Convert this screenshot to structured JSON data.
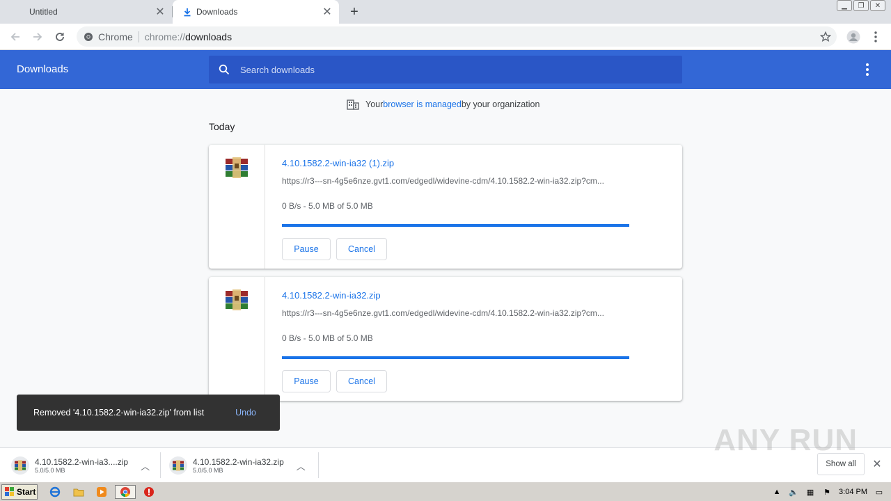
{
  "browser": {
    "tabs": [
      {
        "title": "Untitled",
        "active": false
      },
      {
        "title": "Downloads",
        "active": true
      }
    ],
    "new_tab_label": "+",
    "omnibox": {
      "chip_label": "Chrome",
      "url_scheme": "chrome://",
      "url_path": "downloads"
    }
  },
  "downloads_page": {
    "title": "Downloads",
    "search_placeholder": "Search downloads",
    "managed_notice": {
      "prefix": "Your ",
      "link": "browser is managed",
      "suffix": " by your organization"
    },
    "section_label": "Today",
    "items": [
      {
        "filename": "4.10.1582.2-win-ia32 (1).zip",
        "url": "https://r3---sn-4g5e6nze.gvt1.com/edgedl/widevine-cdm/4.10.1582.2-win-ia32.zip?cm...",
        "status": "0 B/s - 5.0 MB of 5.0 MB",
        "progress_percent": 100,
        "pause_label": "Pause",
        "cancel_label": "Cancel"
      },
      {
        "filename": "4.10.1582.2-win-ia32.zip",
        "url": "https://r3---sn-4g5e6nze.gvt1.com/edgedl/widevine-cdm/4.10.1582.2-win-ia32.zip?cm...",
        "status": "0 B/s - 5.0 MB of 5.0 MB",
        "progress_percent": 100,
        "pause_label": "Pause",
        "cancel_label": "Cancel"
      }
    ],
    "toast": {
      "message": "Removed '4.10.1582.2-win-ia32.zip' from list",
      "action": "Undo"
    }
  },
  "shelf": {
    "items": [
      {
        "name": "4.10.1582.2-win-ia3....zip",
        "size": "5.0/5.0 MB"
      },
      {
        "name": "4.10.1582.2-win-ia32.zip",
        "size": "5.0/5.0 MB"
      }
    ],
    "show_all_label": "Show all",
    "watermark": "ANY RUN"
  },
  "taskbar": {
    "start_label": "Start",
    "pinned_icons": [
      "ie-icon",
      "folder-icon",
      "media-player-icon",
      "chrome-icon",
      "stop-icon"
    ],
    "clock": "3:04 PM"
  },
  "colors": {
    "header_blue": "#3367d6",
    "link_blue": "#1a73e8",
    "toast_bg": "#323232"
  }
}
